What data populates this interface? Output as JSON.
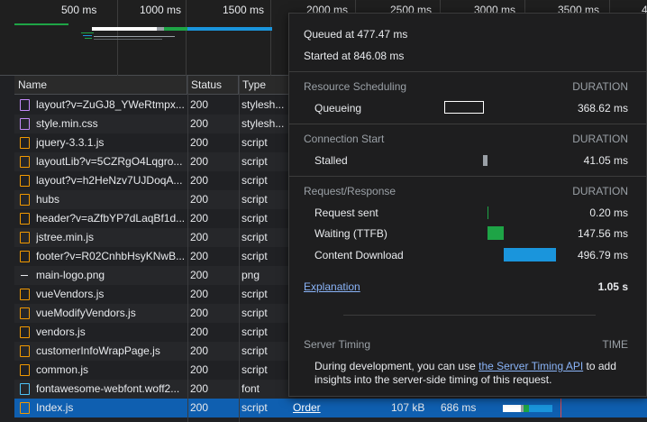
{
  "overview": {
    "ticks": [
      "500 ms",
      "1000 ms",
      "1500 ms",
      "2000 ms",
      "2500 ms",
      "3000 ms",
      "3500 ms",
      "4"
    ]
  },
  "table": {
    "columns": [
      "Name",
      "Status",
      "Type"
    ],
    "rows": [
      {
        "name": "layout?v=ZuGJ8_YWeRtmpx...",
        "status": "200",
        "type": "stylesh...",
        "icon": "stylesheet-file-icon"
      },
      {
        "name": "style.min.css",
        "status": "200",
        "type": "stylesh...",
        "icon": "stylesheet-file-icon"
      },
      {
        "name": "jquery-3.3.1.js",
        "status": "200",
        "type": "script",
        "icon": "script-file-icon"
      },
      {
        "name": "layoutLib?v=5CZRgO4Lqgro...",
        "status": "200",
        "type": "script",
        "icon": "script-file-icon"
      },
      {
        "name": "layout?v=h2HeNzv7UJDoqA...",
        "status": "200",
        "type": "script",
        "icon": "script-file-icon"
      },
      {
        "name": "hubs",
        "status": "200",
        "type": "script",
        "icon": "script-file-icon"
      },
      {
        "name": "header?v=aZfbYP7dLaqBf1d...",
        "status": "200",
        "type": "script",
        "icon": "script-file-icon"
      },
      {
        "name": "jstree.min.js",
        "status": "200",
        "type": "script",
        "icon": "script-file-icon"
      },
      {
        "name": "footer?v=R02CnhbHsyKNwB...",
        "status": "200",
        "type": "script",
        "icon": "script-file-icon"
      },
      {
        "name": "main-logo.png",
        "status": "200",
        "type": "png",
        "icon": "image-file-icon"
      },
      {
        "name": "vueVendors.js",
        "status": "200",
        "type": "script",
        "icon": "script-file-icon"
      },
      {
        "name": "vueModifyVendors.js",
        "status": "200",
        "type": "script",
        "icon": "script-file-icon"
      },
      {
        "name": "vendors.js",
        "status": "200",
        "type": "script",
        "icon": "script-file-icon"
      },
      {
        "name": "customerInfoWrapPage.js",
        "status": "200",
        "type": "script",
        "icon": "script-file-icon"
      },
      {
        "name": "common.js",
        "status": "200",
        "type": "script",
        "icon": "script-file-icon"
      },
      {
        "name": "fontawesome-webfont.woff2...",
        "status": "200",
        "type": "font",
        "icon": "font-file-icon"
      },
      {
        "name": "Index.js",
        "status": "200",
        "type": "script",
        "icon": "script-file-icon",
        "initiator": "Order",
        "size": "107 kB",
        "time": "686 ms",
        "selected": true
      }
    ]
  },
  "popup": {
    "queued_at": "Queued at 477.47 ms",
    "started_at": "Started at 846.08 ms",
    "sections": [
      {
        "title": "Resource Scheduling",
        "duration_label": "DURATION",
        "items": [
          {
            "label": "Queueing",
            "value": "368.62 ms"
          }
        ]
      },
      {
        "title": "Connection Start",
        "duration_label": "DURATION",
        "items": [
          {
            "label": "Stalled",
            "value": "41.05 ms"
          }
        ]
      },
      {
        "title": "Request/Response",
        "duration_label": "DURATION",
        "items": [
          {
            "label": "Request sent",
            "value": "0.20 ms"
          },
          {
            "label": "Waiting (TTFB)",
            "value": "147.56 ms"
          },
          {
            "label": "Content Download",
            "value": "496.79 ms"
          }
        ]
      }
    ],
    "explanation_link": "Explanation",
    "total": "1.05 s",
    "server_timing": {
      "title": "Server Timing",
      "time_label": "TIME",
      "text_before": "During development, you can use ",
      "link_text": "the Server Timing API",
      "text_after": " to add insights into the server-side timing of this request."
    }
  },
  "colors": {
    "queueing_bar": "#ffffff",
    "stalled_bar": "#9aa0a6",
    "waiting_bar": "#1ea446",
    "download_bar": "#1a95dc",
    "selected_row": "#0f5fb0",
    "link": "#8ab4f8"
  }
}
